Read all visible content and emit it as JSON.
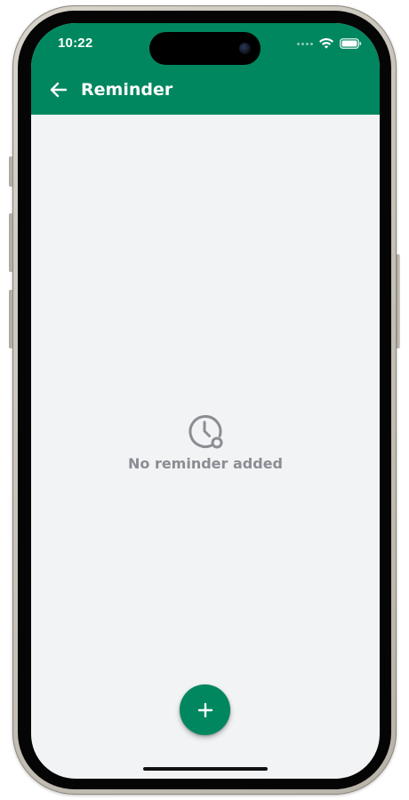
{
  "status_bar": {
    "time": "10:22",
    "icons": [
      "signal-dots-icon",
      "wifi-icon",
      "battery-icon"
    ]
  },
  "app_bar": {
    "title": "Reminder",
    "back_icon": "arrow-left-icon",
    "color": "#00875f"
  },
  "empty_state": {
    "icon": "clock-icon",
    "message": "No reminder added",
    "text_color": "#8a8d92"
  },
  "fab": {
    "icon": "plus-icon",
    "color": "#00875f"
  },
  "colors": {
    "screen_background": "#f2f3f5",
    "accent": "#00875f"
  }
}
